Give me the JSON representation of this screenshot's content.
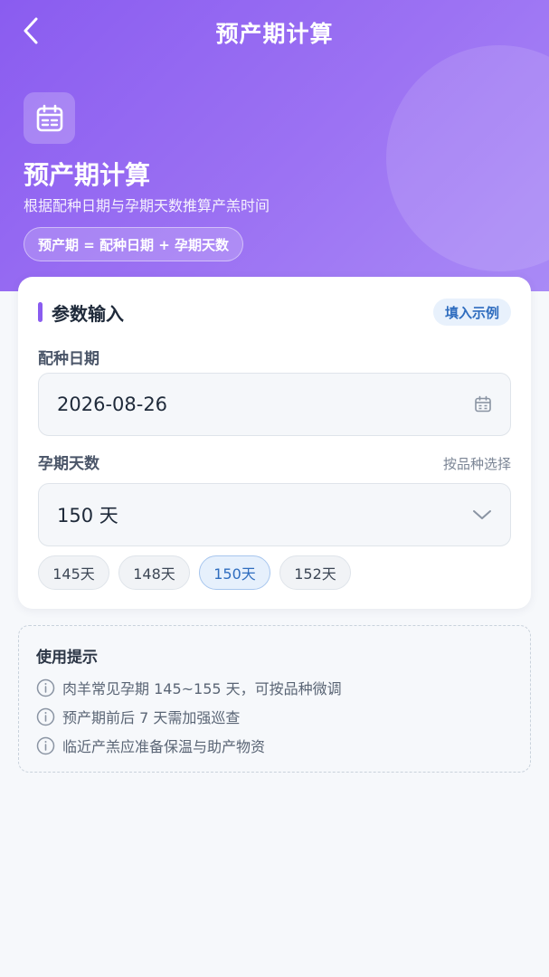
{
  "nav": {
    "title": "预产期计算"
  },
  "hero": {
    "title": "预产期计算",
    "subtitle": "根据配种日期与孕期天数推算产羔时间",
    "formula": "预产期 = 配种日期 + 孕期天数"
  },
  "form": {
    "section_title": "参数输入",
    "example_button": "填入示例",
    "breeding_date_label": "配种日期",
    "breeding_date_value": "2026-08-26",
    "gestation_label": "孕期天数",
    "gestation_hint": "按品种选择",
    "gestation_value": "150 天",
    "chips": [
      {
        "label": "145天",
        "active": false
      },
      {
        "label": "148天",
        "active": false
      },
      {
        "label": "150天",
        "active": true
      },
      {
        "label": "152天",
        "active": false
      }
    ]
  },
  "tips": {
    "title": "使用提示",
    "items": [
      "肉羊常见孕期 145~155 天，可按品种微调",
      "预产期前后 7 天需加强巡查",
      "临近产羔应准备保温与助产物资"
    ]
  },
  "colors": {
    "accent": "#8a5cf0",
    "link": "#2f6dbf"
  },
  "icons": [
    "back-icon",
    "calendar-icon",
    "chevron-down-icon",
    "info-icon"
  ]
}
